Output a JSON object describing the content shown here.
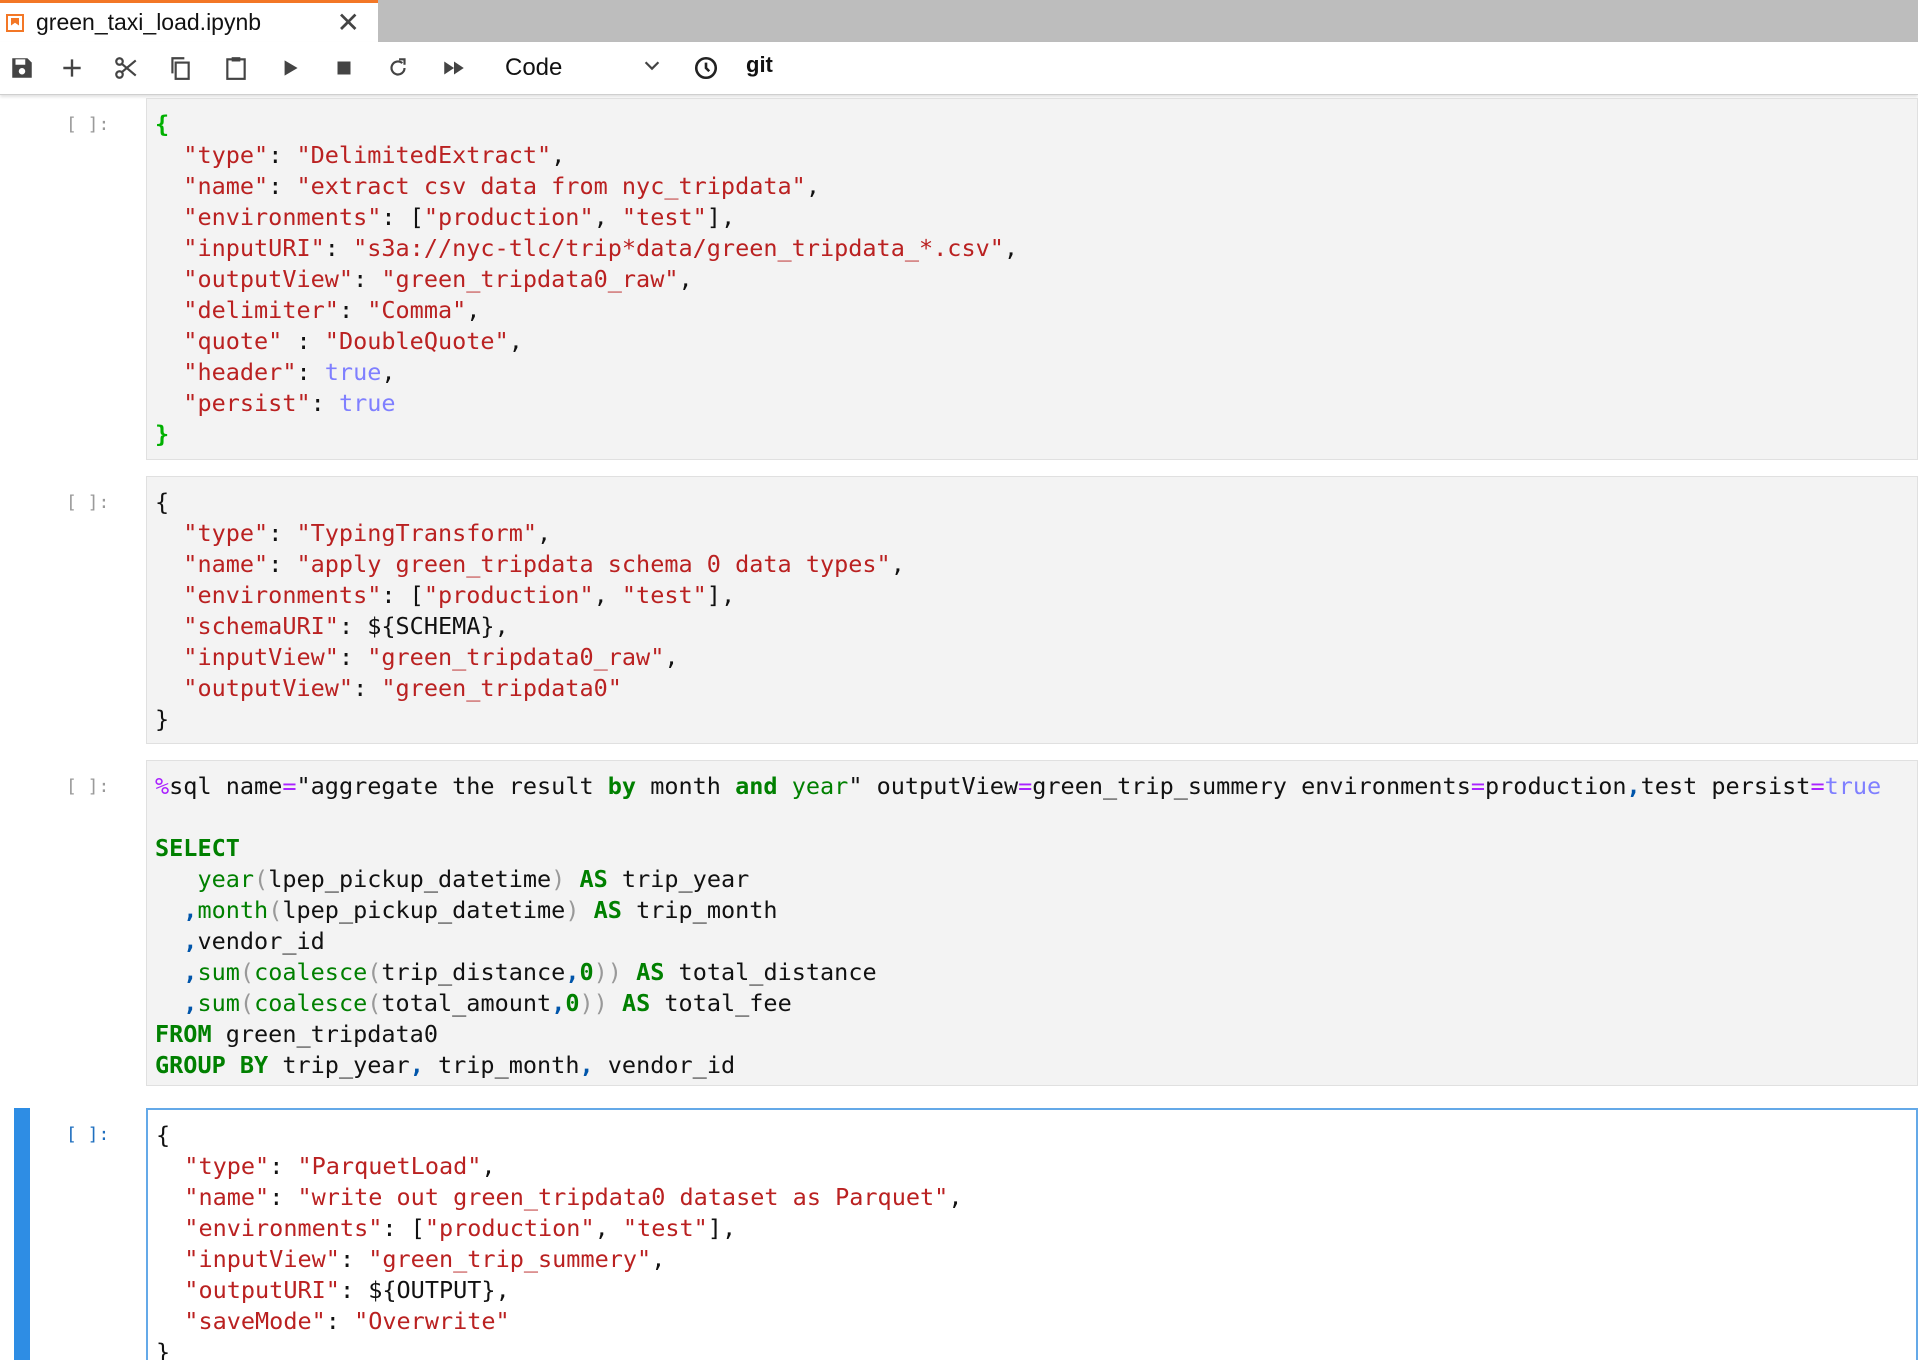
{
  "tab": {
    "title": "green_taxi_load.ipynb"
  },
  "toolbar": {
    "cell_type": "Code",
    "git_label": "git"
  },
  "cells": [
    {
      "prompt": "[ ]:"
    },
    {
      "prompt": "[ ]:"
    },
    {
      "prompt": "[ ]:"
    },
    {
      "prompt": "[ ]:"
    }
  ],
  "colors": {
    "accent": "#f37726",
    "active_cell": "#2e8de4"
  }
}
